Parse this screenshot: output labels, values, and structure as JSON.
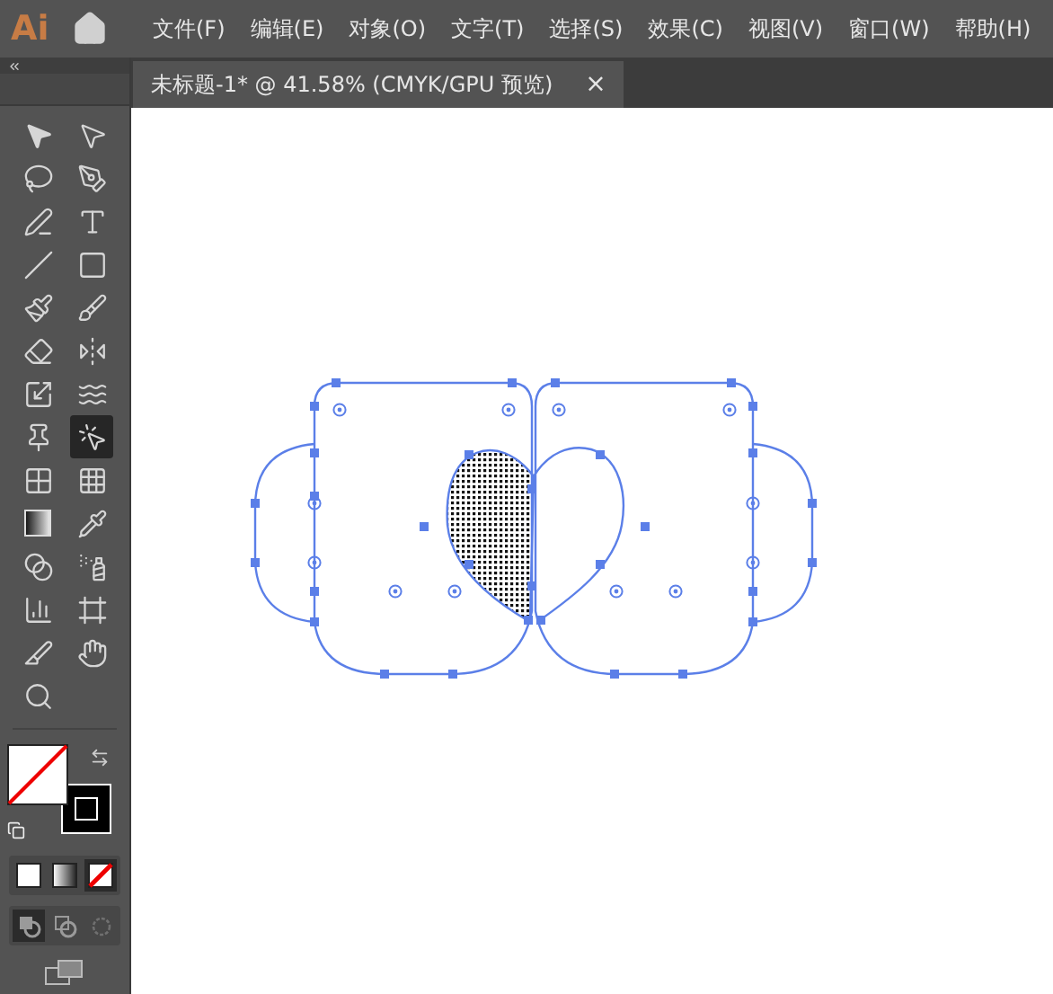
{
  "app": {
    "logo": "Ai"
  },
  "menu": [
    {
      "label": "文件(F)"
    },
    {
      "label": "编辑(E)"
    },
    {
      "label": "对象(O)"
    },
    {
      "label": "文字(T)"
    },
    {
      "label": "选择(S)"
    },
    {
      "label": "效果(C)"
    },
    {
      "label": "视图(V)"
    },
    {
      "label": "窗口(W)"
    },
    {
      "label": "帮助(H)"
    }
  ],
  "document_tab": {
    "title": "未标题-1* @ 41.58% (CMYK/GPU 预览)",
    "close": "×",
    "selected": true
  },
  "tools": [
    {
      "kind": "selection",
      "selected": false
    },
    {
      "kind": "direct",
      "selected": false
    },
    {
      "kind": "lasso",
      "selected": false
    },
    {
      "kind": "pen",
      "selected": false
    },
    {
      "kind": "curvature",
      "selected": false
    },
    {
      "kind": "type",
      "selected": false
    },
    {
      "kind": "line",
      "selected": false
    },
    {
      "kind": "rectangle",
      "selected": false
    },
    {
      "kind": "brush",
      "selected": false
    },
    {
      "kind": "shaper",
      "selected": false
    },
    {
      "kind": "eraser",
      "selected": false
    },
    {
      "kind": "reflect",
      "selected": false
    },
    {
      "kind": "scale",
      "selected": false
    },
    {
      "kind": "warp",
      "selected": false
    },
    {
      "kind": "pin",
      "selected": false
    },
    {
      "kind": "shapebuilder",
      "selected": true
    },
    {
      "kind": "perspective",
      "selected": false
    },
    {
      "kind": "mesh",
      "selected": false
    },
    {
      "kind": "gradient",
      "selected": false
    },
    {
      "kind": "eyedropper",
      "selected": false
    },
    {
      "kind": "blend",
      "selected": false
    },
    {
      "kind": "spray",
      "selected": false
    },
    {
      "kind": "graph",
      "selected": false
    },
    {
      "kind": "artboard",
      "selected": false
    },
    {
      "kind": "slice",
      "selected": false
    },
    {
      "kind": "hand",
      "selected": false
    },
    {
      "kind": "zoom",
      "selected": false
    }
  ],
  "fill_modes": [
    {
      "kind": "color",
      "selected": false
    },
    {
      "kind": "gradient",
      "selected": false
    },
    {
      "kind": "none",
      "selected": true
    }
  ],
  "draw_modes": [
    {
      "kind": "normal",
      "selected": true
    },
    {
      "kind": "behind",
      "selected": false
    },
    {
      "kind": "inside",
      "selected": false
    }
  ]
}
